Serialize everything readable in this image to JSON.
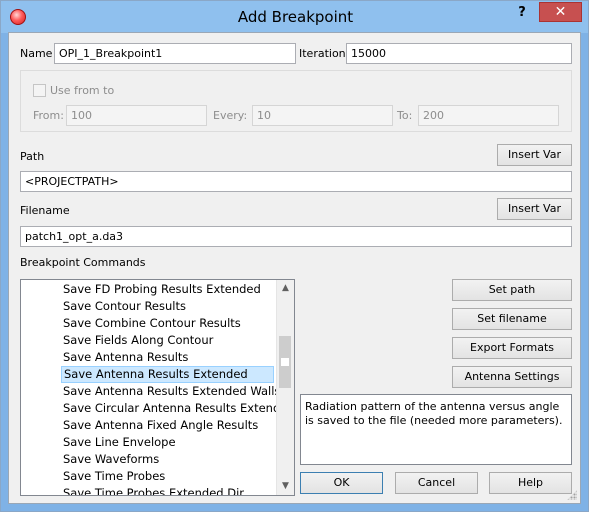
{
  "window": {
    "title": "Add Breakpoint",
    "help_label": "?",
    "close_label": "✕"
  },
  "form": {
    "name_label": "Name",
    "name_value": "OPI_1_Breakpoint1",
    "iteration_label": "Iteration",
    "iteration_value": "15000",
    "use_from_to_label": "Use from to",
    "from_label": "From:",
    "from_value": "100",
    "every_label": "Every:",
    "every_value": "10",
    "to_label": "To:",
    "to_value": "200",
    "path_label": "Path",
    "path_value": "<PROJECTPATH>",
    "insert_var_label": "Insert Var",
    "filename_label": "Filename",
    "filename_value": "patch1_opt_a.da3",
    "commands_label": "Breakpoint Commands"
  },
  "commands": {
    "items": [
      "Save FD Probing Results Extended",
      "Save Contour Results",
      "Save Combine Contour Results",
      "Save Fields Along Contour",
      "Save Antenna Results",
      "Save Antenna Results Extended",
      "Save Antenna Results Extended Walls",
      "Save Circular Antenna Results Extend...",
      "Save Antenna Fixed Angle Results",
      "Save Line Envelope",
      "Save Waveforms",
      "Save Time Probes",
      "Save Time Probes Extended Dir"
    ],
    "selected_index": 5
  },
  "side_buttons": {
    "set_path": "Set path",
    "set_filename": "Set filename",
    "export_formats": "Export Formats",
    "antenna_settings": "Antenna Settings"
  },
  "description": "Radiation pattern of the antenna versus angle is saved to the file (needed more parameters).",
  "footer": {
    "ok": "OK",
    "cancel": "Cancel",
    "help": "Help"
  }
}
